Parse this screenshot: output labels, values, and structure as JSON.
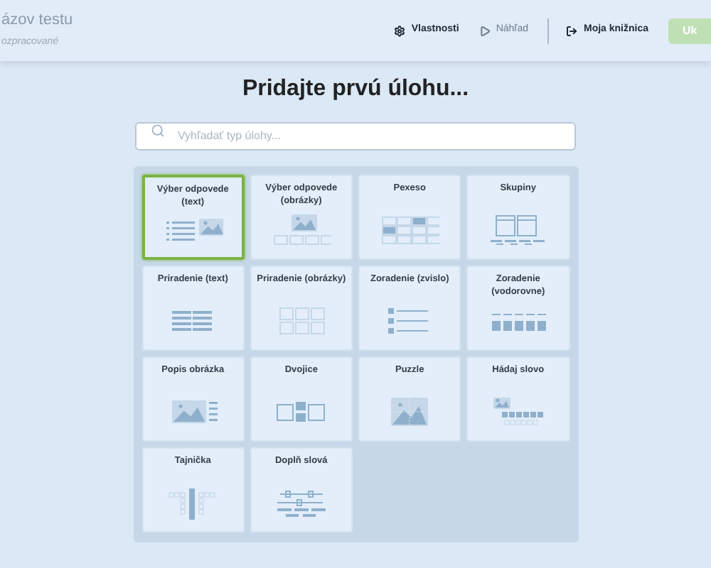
{
  "header": {
    "title": "ázov testu",
    "status": "ozpracované",
    "actions": [
      {
        "kind": "settings",
        "label": "Vlastnosti"
      },
      {
        "kind": "preview",
        "label": "Náhľad"
      },
      {
        "kind": "library",
        "label": "Moja knižnica"
      }
    ],
    "save_button": "Uk"
  },
  "heading": "Pridajte prvú úlohu...",
  "search": {
    "placeholder": "Vyhľadať typ úlohy..."
  },
  "task_types": [
    {
      "label": "Výber odpovede (text)",
      "kind": "list-image",
      "selected": true
    },
    {
      "label": "Výber odpovede (obrázky)",
      "kind": "image-options",
      "selected": false
    },
    {
      "label": "Pexeso",
      "kind": "memory",
      "selected": false
    },
    {
      "label": "Skupiny",
      "kind": "groups",
      "selected": false
    },
    {
      "label": "Priradenie (text)",
      "kind": "text-rows",
      "selected": false
    },
    {
      "label": "Priradenie (obrázky)",
      "kind": "image-pairs",
      "selected": false
    },
    {
      "label": "Zoradenie (zvislo)",
      "kind": "vertical",
      "selected": false
    },
    {
      "label": "Zoradenie (vodorovne)",
      "kind": "horizontal",
      "selected": false
    },
    {
      "label": "Popis obrázka",
      "kind": "image-label",
      "selected": false
    },
    {
      "label": "Dvojice",
      "kind": "pairs",
      "selected": false
    },
    {
      "label": "Puzzle",
      "kind": "puzzle",
      "selected": false
    },
    {
      "label": "Hádaj slovo",
      "kind": "word",
      "selected": false
    },
    {
      "label": "Tajnička",
      "kind": "crossword",
      "selected": false
    },
    {
      "label": "Doplň slová",
      "kind": "fill",
      "selected": false
    }
  ]
}
